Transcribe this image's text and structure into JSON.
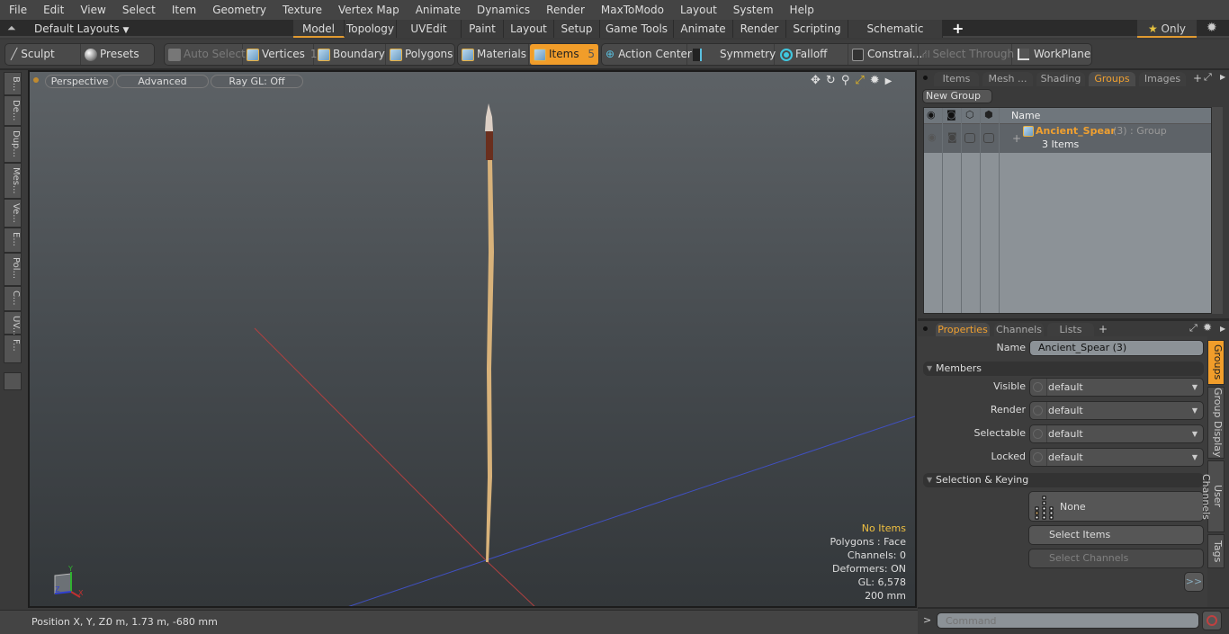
{
  "menu": [
    "File",
    "Edit",
    "View",
    "Select",
    "Item",
    "Geometry",
    "Texture",
    "Vertex Map",
    "Animate",
    "Dynamics",
    "Render",
    "MaxToModo",
    "Layout",
    "System",
    "Help"
  ],
  "layoutbar": {
    "layouts_label": "Default Layouts",
    "tabs": [
      "Model",
      "Topology",
      "UVEdit",
      "Paint",
      "Layout",
      "Setup",
      "Game Tools",
      "Animate",
      "Render",
      "Scripting",
      "Schematic Fusion"
    ],
    "active_tab": "Model",
    "add_label": "+",
    "only_label": "Only"
  },
  "toolbar": {
    "sculpt": "Sculpt",
    "presets": "Presets",
    "auto_select": "Auto Select",
    "vertices": "Vertices",
    "vertices_count": "1",
    "boundary": "Boundary",
    "polygons": "Polygons",
    "materials": "Materials",
    "items": "Items",
    "items_count": "5",
    "action_center": "Action Center",
    "symmetry": "Symmetry",
    "falloff": "Falloff",
    "constraints": "Constrai...",
    "select_through": "Select Through",
    "workplane": "WorkPlane"
  },
  "left_tabs": [
    "B...",
    "De...",
    "Dup...",
    "Mes...",
    "Ve...",
    "E...",
    "Pol...",
    "C...",
    "UV...",
    "F..."
  ],
  "viewport": {
    "perspective": "Perspective",
    "advanced": "Advanced",
    "raygl": "Ray GL: Off",
    "info": {
      "selection": "No Items",
      "polygons": "Polygons : Face",
      "channels": "Channels: 0",
      "deformers": "Deformers: ON",
      "gl": "GL: 6,578",
      "scale": "200 mm"
    },
    "axis_labels": {
      "x": "X",
      "y": "Y",
      "z": "Z"
    }
  },
  "status": {
    "position_label": "Position X, Y, Z:",
    "position_value": "0 m, 1.73 m, -680 mm"
  },
  "right_top": {
    "tabs": [
      "Items",
      "Mesh ...",
      "Shading",
      "Groups",
      "Images"
    ],
    "active_tab": "Groups",
    "new_group": "New Group",
    "column_name": "Name",
    "group": {
      "name": "Ancient_Spear",
      "count": "(3)",
      "type": ": Group",
      "items_label": "3 Items"
    }
  },
  "properties": {
    "tabs": [
      "Properties",
      "Channels",
      "Lists"
    ],
    "active_tab": "Properties",
    "name_label": "Name",
    "name_value": "Ancient_Spear (3)",
    "members_section": "Members",
    "fields": [
      {
        "label": "Visible",
        "value": "default"
      },
      {
        "label": "Render",
        "value": "default"
      },
      {
        "label": "Selectable",
        "value": "default"
      },
      {
        "label": "Locked",
        "value": "default"
      }
    ],
    "selection_section": "Selection & Keying",
    "none_label": "None",
    "select_items": "Select Items",
    "select_channels": "Select Channels",
    "more": ">>",
    "side_tabs": [
      "Groups",
      "Group Display",
      "User Channels",
      "Tags"
    ],
    "active_side_tab": "Groups"
  },
  "command": {
    "prompt": ">",
    "placeholder": "Command"
  },
  "colors": {
    "accent": "#f19d2a",
    "group_name": "#f0a030"
  }
}
